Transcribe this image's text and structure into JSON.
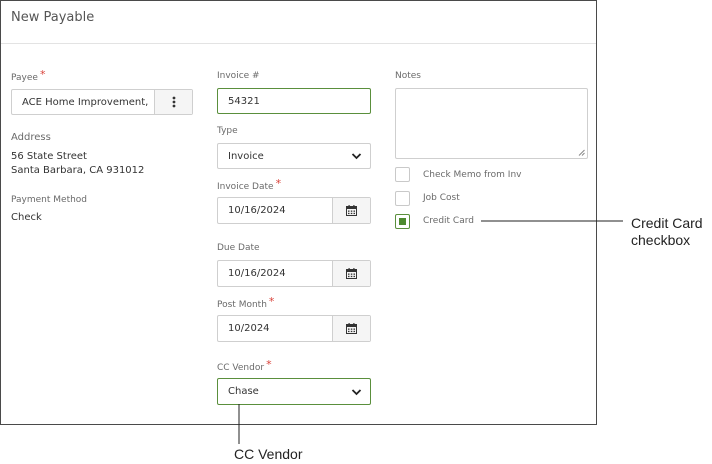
{
  "dialog": {
    "title": "New Payable"
  },
  "payee": {
    "label": "Payee",
    "required": "*",
    "value": "ACE Home Improvement, Inc.",
    "menu_icon": "kebab-vertical-icon"
  },
  "address": {
    "label": "Address",
    "line1": "56 State Street",
    "line2": "Santa Barbara, CA 931012"
  },
  "payment_method": {
    "label": "Payment Method",
    "value": "Check"
  },
  "invoice_number": {
    "label": "Invoice #",
    "value": "54321"
  },
  "type": {
    "label": "Type",
    "value": "Invoice"
  },
  "invoice_date": {
    "label": "Invoice Date",
    "required": "*",
    "value": "10/16/2024",
    "icon": "calendar-icon"
  },
  "due_date": {
    "label": "Due Date",
    "value": "10/16/2024",
    "icon": "calendar-icon"
  },
  "post_month": {
    "label": "Post Month",
    "required": "*",
    "value": "10/2024",
    "icon": "calendar-icon"
  },
  "cc_vendor": {
    "label": "CC Vendor",
    "required": "*",
    "value": "Chase"
  },
  "notes": {
    "label": "Notes",
    "value": ""
  },
  "checkboxes": [
    {
      "label": "Check Memo from Inv",
      "checked": false
    },
    {
      "label": "Job Cost",
      "checked": false
    },
    {
      "label": "Credit Card",
      "checked": true
    }
  ],
  "callouts": {
    "credit_card_line1": "Credit Card",
    "credit_card_line2": "checkbox",
    "cc_vendor": "CC Vendor"
  },
  "colors": {
    "accent_green": "#5a8f3c",
    "required_red": "#d9423a",
    "border": "#cfcfcf"
  }
}
